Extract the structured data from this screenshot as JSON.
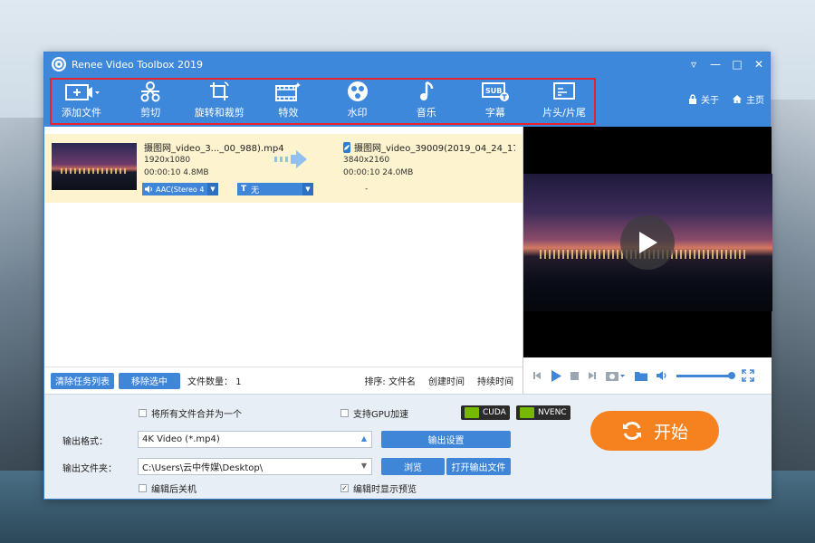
{
  "window": {
    "title": "Renee Video Toolbox 2019",
    "controls": [
      "▿",
      "—",
      "□",
      "✕"
    ]
  },
  "toolbar": {
    "tools": [
      {
        "label": "添加文件",
        "icon": "add-file-icon"
      },
      {
        "label": "剪切",
        "icon": "scissors-icon"
      },
      {
        "label": "旋转和裁剪",
        "icon": "crop-rotate-icon"
      },
      {
        "label": "特效",
        "icon": "effects-icon"
      },
      {
        "label": "水印",
        "icon": "watermark-icon"
      },
      {
        "label": "音乐",
        "icon": "music-note-icon"
      },
      {
        "label": "字幕",
        "icon": "subtitle-icon"
      },
      {
        "label": "片头/片尾",
        "icon": "intro-outro-icon"
      }
    ],
    "about": "关于",
    "home": "主页"
  },
  "file": {
    "source_name": "摄图网_video_3..._00_988).mp4",
    "source_res": "1920x1080",
    "source_time": "00:00:10",
    "source_size": "4.8MB",
    "output_name": "摄图网_video_39009(2019_04_24_17_(",
    "output_res": "3840x2160",
    "output_time": "00:00:10",
    "output_size": "24.0MB",
    "audio": "AAC(Stereo 4",
    "subtitle": "无",
    "dash": "-"
  },
  "list_bar": {
    "clear_label": "清除任务列表",
    "remove_label": "移除选中",
    "count_label": "文件数量：",
    "count": "1",
    "sort_label": "排序:",
    "sort_name": "文件名",
    "sort_created": "创建时间",
    "sort_duration": "持续时间"
  },
  "bottom": {
    "merge_label": "将所有文件合并为一个",
    "gpu_label": "支持GPU加速",
    "cuda": "CUDA",
    "nvenc": "NVENC",
    "format_label": "输出格式：",
    "format_value": "4K Video (*.mp4)",
    "output_settings": "输出设置",
    "folder_label": "输出文件夹：",
    "folder_value": "C:\\Users\\云中传媒\\Desktop\\",
    "browse": "浏览",
    "open_output": "打开输出文件",
    "shutdown_label": "编辑后关机",
    "preview_label": "编辑时显示预览",
    "start": "开始"
  },
  "colors": {
    "titlebar": "#3e88dc",
    "highlight_box": "#e8222c",
    "button_blue": "#3f86d9",
    "start_orange": "#f5821f",
    "file_row": "#fdf3cf"
  }
}
